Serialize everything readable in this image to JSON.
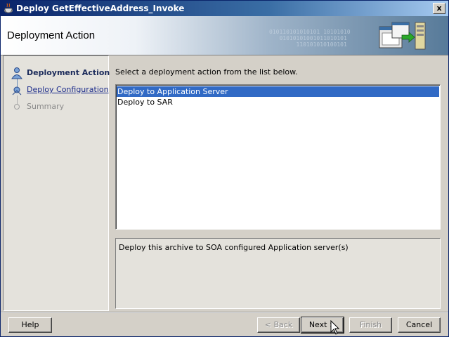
{
  "window": {
    "title": "Deploy GetEffectiveAddress_Invoke",
    "close_label": "x"
  },
  "header": {
    "title": "Deployment Action",
    "binary_text": "010110101010101 10101010\n   01010101001011010101\n        110101010100101"
  },
  "steps": [
    {
      "label": "Deployment Action",
      "state": "active"
    },
    {
      "label": "Deploy Configuration",
      "state": "link"
    },
    {
      "label": "Summary",
      "state": "disabled"
    }
  ],
  "main": {
    "instruction": "Select a deployment action from the list below.",
    "actions": [
      {
        "label": "Deploy to Application Server",
        "selected": true
      },
      {
        "label": "Deploy to SAR",
        "selected": false
      }
    ],
    "description": "Deploy this archive to SOA configured Application server(s)"
  },
  "buttons": {
    "help": "Help",
    "back": "< Back",
    "next": "Next >",
    "finish": "Finish",
    "cancel": "Cancel"
  },
  "colors": {
    "selection": "#316ac5",
    "titlebar": "#0a246a"
  }
}
